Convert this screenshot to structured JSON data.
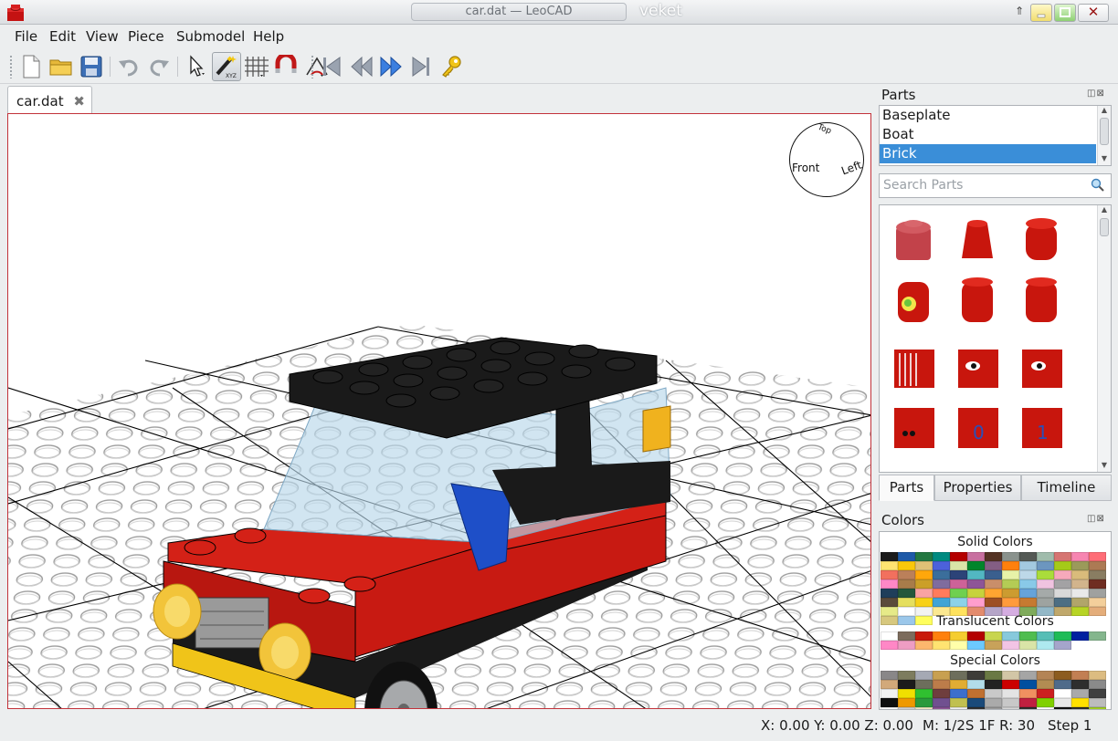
{
  "window": {
    "title": "car.dat — LeoCAD",
    "host": "veket",
    "pin": "⇑",
    "minimize": "",
    "maximize": "",
    "close": "✕"
  },
  "menu": [
    {
      "label": "File"
    },
    {
      "label": "Edit"
    },
    {
      "label": "View"
    },
    {
      "label": "Piece"
    },
    {
      "label": "Submodel"
    },
    {
      "label": "Help"
    }
  ],
  "toolbar": {
    "buttons": [
      "new-file",
      "open-file",
      "save-file",
      "undo",
      "redo",
      "select",
      "rotate-xyz",
      "snap-grid",
      "magnet",
      "measure-angle",
      "first-step",
      "previous-step",
      "next-step",
      "last-step",
      "key"
    ],
    "active": "rotate-xyz",
    "xyz_label": "XYZ"
  },
  "document_tab": {
    "label": "car.dat",
    "close": "✖"
  },
  "view_sphere": {
    "front": "Front",
    "left": "Left",
    "top": "Top"
  },
  "parts_panel": {
    "title": "Parts",
    "categories": [
      {
        "label": "Baseplate",
        "selected": false
      },
      {
        "label": "Boat",
        "selected": false
      },
      {
        "label": "Brick",
        "selected": true
      }
    ],
    "search_placeholder": "Search Parts",
    "tabs": [
      {
        "label": "Parts",
        "active": true
      },
      {
        "label": "Properties",
        "active": false
      },
      {
        "label": "Timeline",
        "active": false
      }
    ]
  },
  "colors_panel": {
    "title": "Colors",
    "solid_title": "Solid Colors",
    "translucent_title": "Translucent Colors",
    "special_title": "Special Colors",
    "solid": [
      "#1b1b1b",
      "#1e5aa8",
      "#237841",
      "#008a80",
      "#b40000",
      "#c870a0",
      "#543324",
      "#8a928d",
      "#545955",
      "#a0bcac",
      "#d67572",
      "#f785b1",
      "#ff6d77",
      "#ffe371",
      "#fac80a",
      "#dfc176",
      "#4c61db",
      "#d9e4a7",
      "#00852b",
      "#845e84",
      "#ff800d",
      "#a3c9e0",
      "#6c96bf",
      "#a5ca18",
      "#9b9a5a",
      "#ac7a54",
      "#f2705e",
      "#bb805a",
      "#ffa70b",
      "#3b6e9b",
      "#2c4378",
      "#52b7c2",
      "#3a5f8e",
      "#e7f2a8",
      "#bdd8e8",
      "#aadc3b",
      "#f6a9bb",
      "#d9bb7b",
      "#897d62",
      "#ff87c6",
      "#a87c4a",
      "#cb9f29",
      "#7f6c9e",
      "#cd6298",
      "#8e5597",
      "#c98e6a",
      "#b4cc55",
      "#89c9e8",
      "#f0c3e0",
      "#a3a2a4",
      "#d2b48c",
      "#6f2d22",
      "#1f3e5a",
      "#24573b",
      "#f9a3a3",
      "#ff7b5c",
      "#6fd04f",
      "#c7d23c",
      "#ffa531",
      "#cc9c30",
      "#66a3d9",
      "#a5aaa9",
      "#d9d9d9",
      "#e9e9e9",
      "#a0a19f",
      "#5a4a3a",
      "#e5df5e",
      "#f7d117",
      "#40a4d6",
      "#8cd2e8",
      "#ff9ecd",
      "#9d4f23",
      "#ff9b3c",
      "#c67a31",
      "#9ea3a0",
      "#4d6e83",
      "#b1a56a",
      "#f3cf9b",
      "#e6ea88",
      "#ffffff",
      "#f2f3f2",
      "#fbe890",
      "#ffe25d",
      "#e38b6d",
      "#b5a5c8",
      "#d5ade1",
      "#7fab5b",
      "#93b8c7",
      "#c0a86b",
      "#b7d425",
      "#e4ad7a",
      "#d7c87e",
      "#9bc7ea",
      "#fffe5d"
    ],
    "translucent": [
      "#ffffff",
      "#7c6b5c",
      "#c91a09",
      "#ff800d",
      "#f5cd2f",
      "#b40000",
      "#c8d54e",
      "#87c9dc",
      "#4fbd4f",
      "#56beb6",
      "#1ebc57",
      "#0020a0",
      "#84b68d",
      "#ff87c6",
      "#ee9dc3",
      "#fcb76d",
      "#ffe371",
      "#ffffaa",
      "#6cc9ff",
      "#c8a25a",
      "#f2c4e5",
      "#d9e4a7",
      "#aee9ef",
      "#a5a5cb"
    ],
    "special": [
      "#898788",
      "#7d7c5e",
      "#a5a9b4",
      "#c8a050",
      "#6d6e5c",
      "#3e3c39",
      "#6a7944",
      "#d2c6a6",
      "#a5a5a5",
      "#b48455",
      "#8c5c20",
      "#c27f53",
      "#dcbc81",
      "#d2a97a",
      "#1b1b1b",
      "#6d6e5c",
      "#bd7c4a",
      "#e1ad33",
      "#b2dce9",
      "#222222",
      "#cc0000",
      "#004f9f",
      "#b28c52",
      "#4f6b8a",
      "#2e2e2e",
      "#8a8a8a",
      "#f2f2f2",
      "#f0e000",
      "#30c030",
      "#6f3e3e",
      "#3c6fcc",
      "#c07030",
      "#c9c9c9",
      "#e4e4e4",
      "#f09060",
      "#cc2020",
      "#ffffff",
      "#a9a9a9",
      "#404040",
      "#0f0f0f",
      "#ee9900",
      "#2a9a3c",
      "#705090",
      "#c0c050",
      "#1a4a7a",
      "#aaaaaa",
      "#c8c8c8",
      "#c02040",
      "#80d000",
      "#e9e9e9",
      "#ffe000",
      "#bcbcbc",
      "#ffffff",
      "#d0d0d0",
      "#f0e8c0",
      "#8e5597",
      "#f0f0f0",
      "#303030",
      "#9a9a9a",
      "#d6d6d6",
      "#2f2f2f",
      "#ffffff",
      "#101010",
      "#2c2c2c",
      "#a0d020",
      "#e0e000",
      "#ffffff",
      "#e8e8e8",
      "#c0c0c0",
      "#8a8a8a",
      "#b0b0b0",
      "#dedede"
    ]
  },
  "status": {
    "coords": "X: 0.00 Y: 0.00 Z: 0.00",
    "model": "M: 1/2S 1F R: 30",
    "step": "Step 1"
  }
}
